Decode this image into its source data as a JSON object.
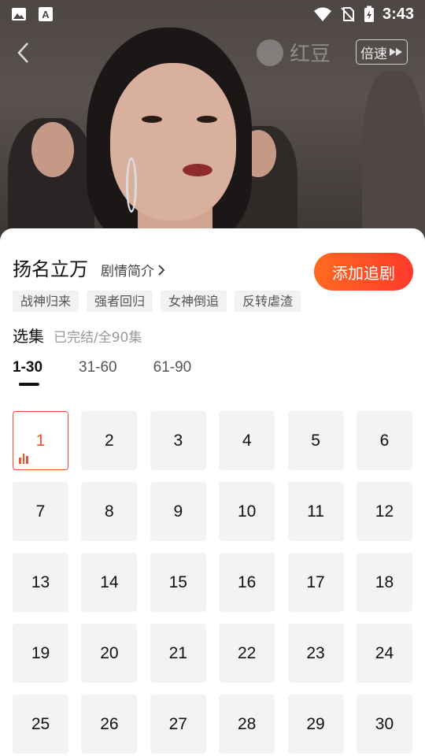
{
  "status_bar": {
    "time": "3:43",
    "left_icons": [
      "image-icon",
      "text-a-icon"
    ],
    "right_icons": [
      "wifi-icon",
      "no-sim-icon",
      "battery-charging-icon"
    ]
  },
  "player": {
    "speed_label": "倍速",
    "watermark_text": "红豆"
  },
  "drama": {
    "title": "扬名立万",
    "synopsis_label": "剧情简介",
    "follow_label": "添加追剧",
    "tags": [
      "战神归来",
      "强者回归",
      "女神倒追",
      "反转虐渣"
    ]
  },
  "episodes": {
    "section_label": "选集",
    "status": "已完结/全90集",
    "ranges": [
      "1-30",
      "31-60",
      "61-90"
    ],
    "active_range": "1-30",
    "current_episode": 1,
    "list": [
      "1",
      "2",
      "3",
      "4",
      "5",
      "6",
      "7",
      "8",
      "9",
      "10",
      "11",
      "12",
      "13",
      "14",
      "15",
      "16",
      "17",
      "18",
      "19",
      "20",
      "21",
      "22",
      "23",
      "24",
      "25",
      "26",
      "27",
      "28",
      "29",
      "30"
    ]
  },
  "colors": {
    "accent": "#f0522c",
    "follow_gradient_start": "#ff6a1e",
    "follow_gradient_end": "#fe3a2d",
    "tile_bg": "#f3f3f3"
  }
}
